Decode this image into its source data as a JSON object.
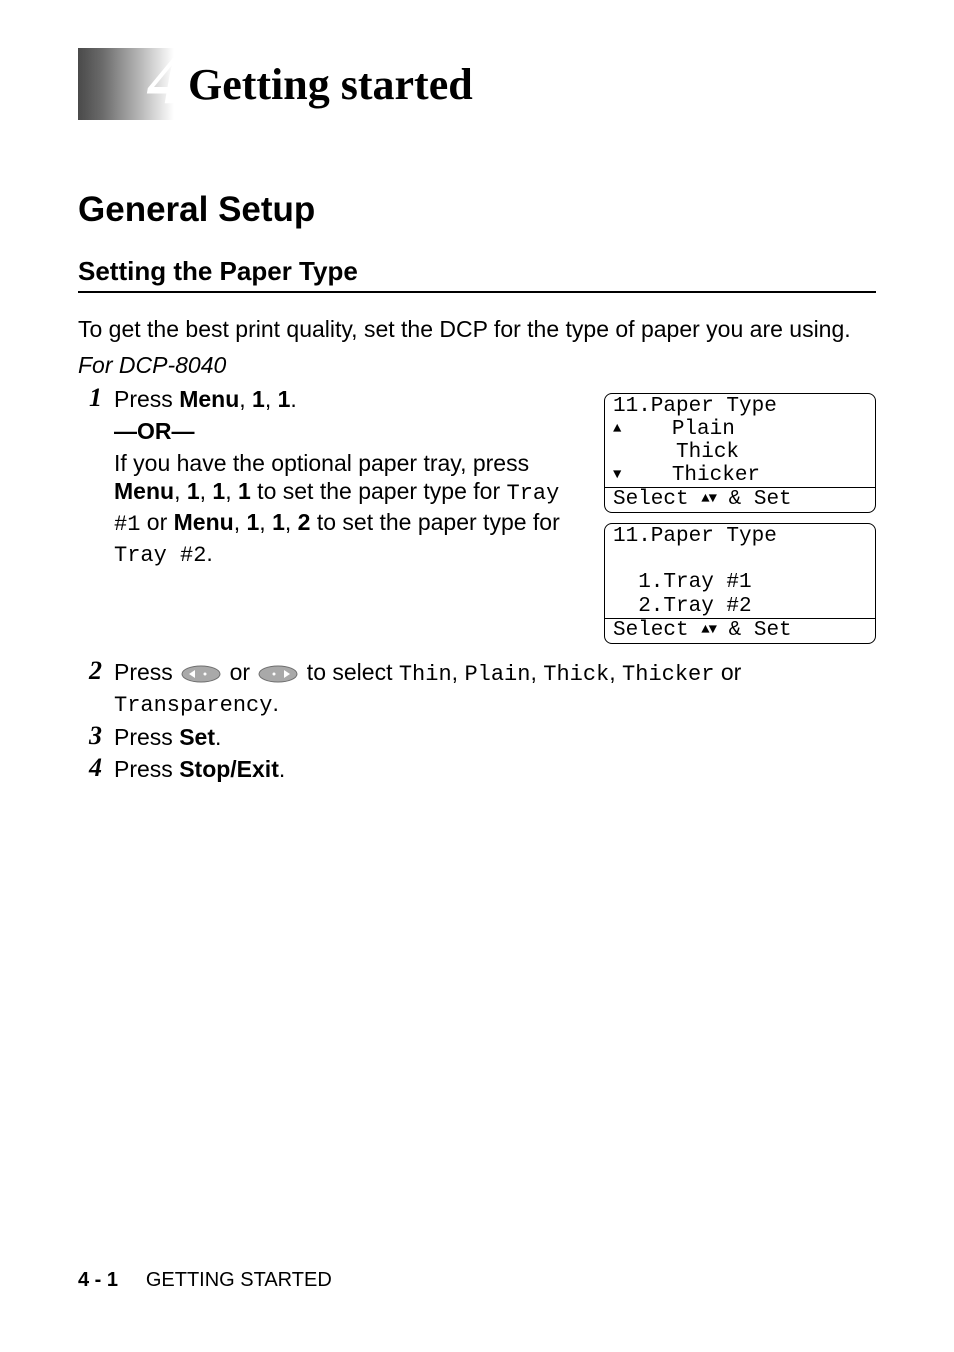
{
  "chapter": {
    "number": "4",
    "title": "Getting started"
  },
  "section": {
    "title": "General Setup"
  },
  "subsection": {
    "title": "Setting the Paper Type"
  },
  "intro": "To get the best print quality, set the DCP for the type of paper you are using.",
  "model_note": "For DCP-8040",
  "steps": {
    "s1": {
      "num": "1",
      "press": "Press ",
      "menu": "Menu",
      "comma1": ", ",
      "one_a": "1",
      "comma2": ", ",
      "one_b": "1",
      "period": ".",
      "or_dash_l": "—",
      "or": "OR",
      "or_dash_r": "—",
      "line2_a": "If you have the optional paper tray, press ",
      "line2_menu": "Menu",
      "line2_b": ", ",
      "line2_c": "1",
      "line2_d": ", ",
      "line2_e": "1",
      "line2_f": ", ",
      "line2_g": "1",
      "line2_h": " to set the paper type for ",
      "line2_tray1": "Tray #1",
      "line2_i": " or ",
      "line2_menu2": "Menu",
      "line2_j": ", ",
      "line2_k": "1",
      "line2_l": ", ",
      "line2_m": "1",
      "line2_n": ", ",
      "line2_o": "2",
      "line2_p": " to set the paper type for ",
      "line2_tray2": "Tray #2",
      "line2_q": "."
    },
    "s2": {
      "num": "2",
      "a": "Press ",
      "b": " or ",
      "c": " to select ",
      "thin": "Thin",
      "comma1": ", ",
      "plain": "Plain",
      "comma2": ", ",
      "thick": "Thick",
      "comma3": ", ",
      "thicker": "Thicker",
      "d": " or ",
      "transparency": "Transparency",
      "period": "."
    },
    "s3": {
      "num": "3",
      "a": "Press ",
      "set": "Set",
      "period": "."
    },
    "s4": {
      "num": "4",
      "a": "Press ",
      "stopexit": "Stop/Exit",
      "period": "."
    }
  },
  "lcd1": {
    "l1": "11.Paper Type",
    "l2_a": "    Plain",
    "l3": "     Thick",
    "l4_a": "    Thicker",
    "footer_a": "Select ",
    "footer_b": " & Set"
  },
  "lcd2": {
    "l1": "11.Paper Type",
    "l2": " ",
    "l3": "  1.Tray #1",
    "l4": "  2.Tray #2",
    "footer_a": "Select ",
    "footer_b": " & Set"
  },
  "footer": {
    "page": "4 - 1",
    "label": "GETTING STARTED"
  }
}
